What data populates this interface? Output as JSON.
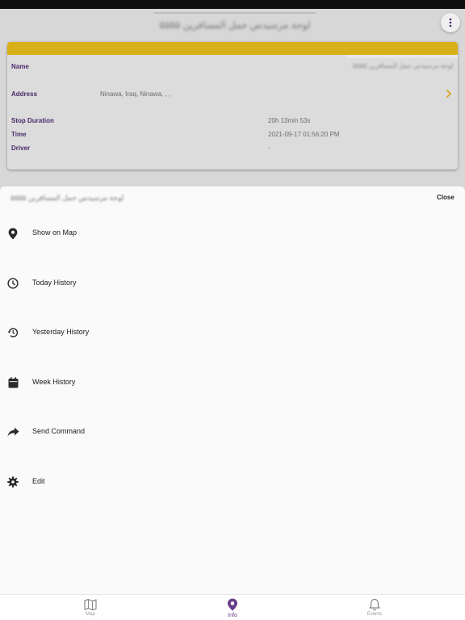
{
  "header": {
    "title": "۵۵۵۵ لوحة مرسيدس حمل المسافرين",
    "menu_icon": "more-vertical-icon"
  },
  "card": {
    "accent_color": "#d8b01a",
    "name_label": "Name",
    "name_value": "۵۵۵۵ لوحة مرسيدس حمل المسافرين",
    "address_label": "Address",
    "address_value": "Ninawa, Iraq, Ninawa, , ,",
    "stop_duration_label": "Stop Duration",
    "stop_duration_value": "20h 13min 53s",
    "time_label": "Time",
    "time_value": "2021-09-17 01:56:20 PM",
    "driver_label": "Driver",
    "driver_value": "-"
  },
  "sheet": {
    "title": "۵۵۵۵ لوحة مرسيدس حمل المسافرين",
    "close_label": "Close",
    "items": [
      {
        "label": "Show on Map",
        "icon": "map-pin-icon"
      },
      {
        "label": "Today History",
        "icon": "clock-icon"
      },
      {
        "label": "Yesterday History",
        "icon": "history-icon"
      },
      {
        "label": "Week History",
        "icon": "calendar-icon"
      },
      {
        "label": "Send Command",
        "icon": "share-forward-icon"
      },
      {
        "label": "Edit",
        "icon": "gear-icon"
      }
    ]
  },
  "nav": {
    "active_color": "#6a3d8a",
    "items": [
      {
        "label": "Map",
        "icon": "map-icon"
      },
      {
        "label": "Info",
        "icon": "location-pin-icon"
      },
      {
        "label": "Events",
        "icon": "bell-icon"
      }
    ]
  }
}
